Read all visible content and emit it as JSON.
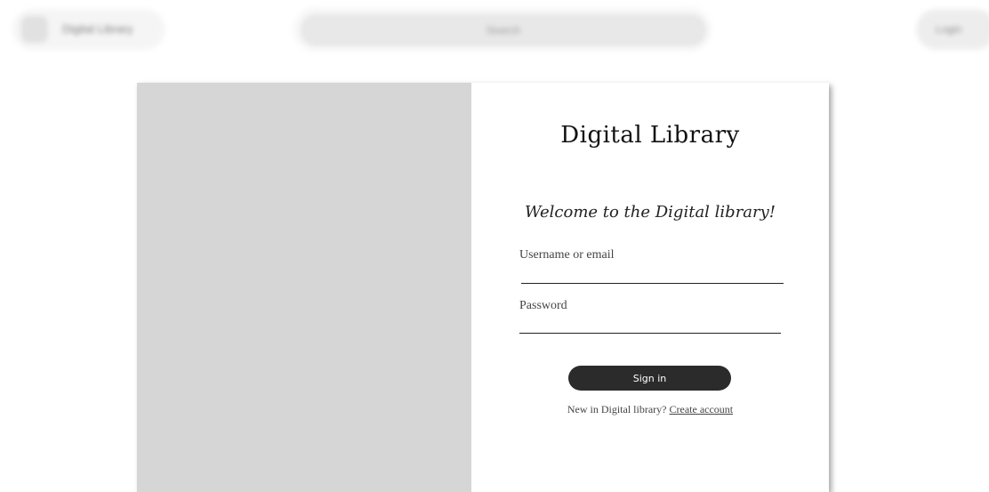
{
  "header": {
    "app_name": "Digital Library",
    "search_placeholder": "Search",
    "login_label": "Login"
  },
  "login_card": {
    "title": "Digital Library",
    "welcome": "Welcome to the Digital library!",
    "username_label": "Username or email",
    "password_label": "Password",
    "sign_in_label": "Sign in",
    "new_prompt": "New in Digital library?",
    "create_account_label": "Create account"
  }
}
